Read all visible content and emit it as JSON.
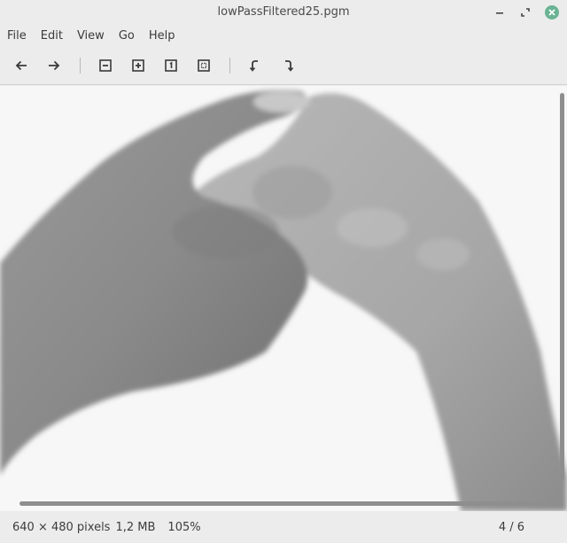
{
  "window": {
    "title": "lowPassFiltered25.pgm",
    "minimize_glyph": "–",
    "maximize_glyph": "⤢"
  },
  "menu": {
    "file": "File",
    "edit": "Edit",
    "view": "View",
    "go": "Go",
    "help": "Help"
  },
  "toolbar": {
    "icons": [
      "arrow-left-icon",
      "arrow-right-icon",
      "zoom-out-icon",
      "zoom-in-icon",
      "zoom-normal-icon",
      "zoom-fit-icon",
      "rotate-left-icon",
      "rotate-right-icon"
    ]
  },
  "image": {
    "description_icon": "grayscale-hands-image"
  },
  "status": {
    "dimensions": "640 × 480 pixels",
    "size": "1,2 MB",
    "zoom": "105%",
    "page": "4 / 6"
  },
  "colors": {
    "close_button": "#6ab394",
    "background": "#ececec",
    "viewer_bg": "#f7f7f7"
  }
}
